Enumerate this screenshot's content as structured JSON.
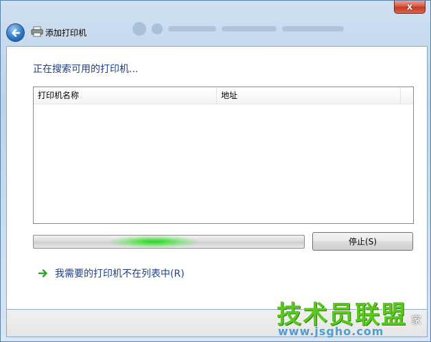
{
  "window": {
    "title": "添加打印机",
    "close_glyph": "x"
  },
  "icons": {
    "back": "back-arrow-icon",
    "title": "printer-icon",
    "link": "green-arrow-icon"
  },
  "content": {
    "heading": "正在搜索可用的打印机...",
    "list": {
      "columns": [
        "打印机名称",
        "地址"
      ]
    },
    "progress": {
      "indeterminate": true
    },
    "stop_label": "停止(S)",
    "link_label": "我需要的打印机不在列表中(R)"
  },
  "watermark": {
    "main": "技术员联盟",
    "url": "www.jsgho.com",
    "suffix": "家"
  },
  "colors": {
    "heading": "#1e3f88",
    "progress_glow": "#2ed02a",
    "close_button": "#d6533a"
  }
}
